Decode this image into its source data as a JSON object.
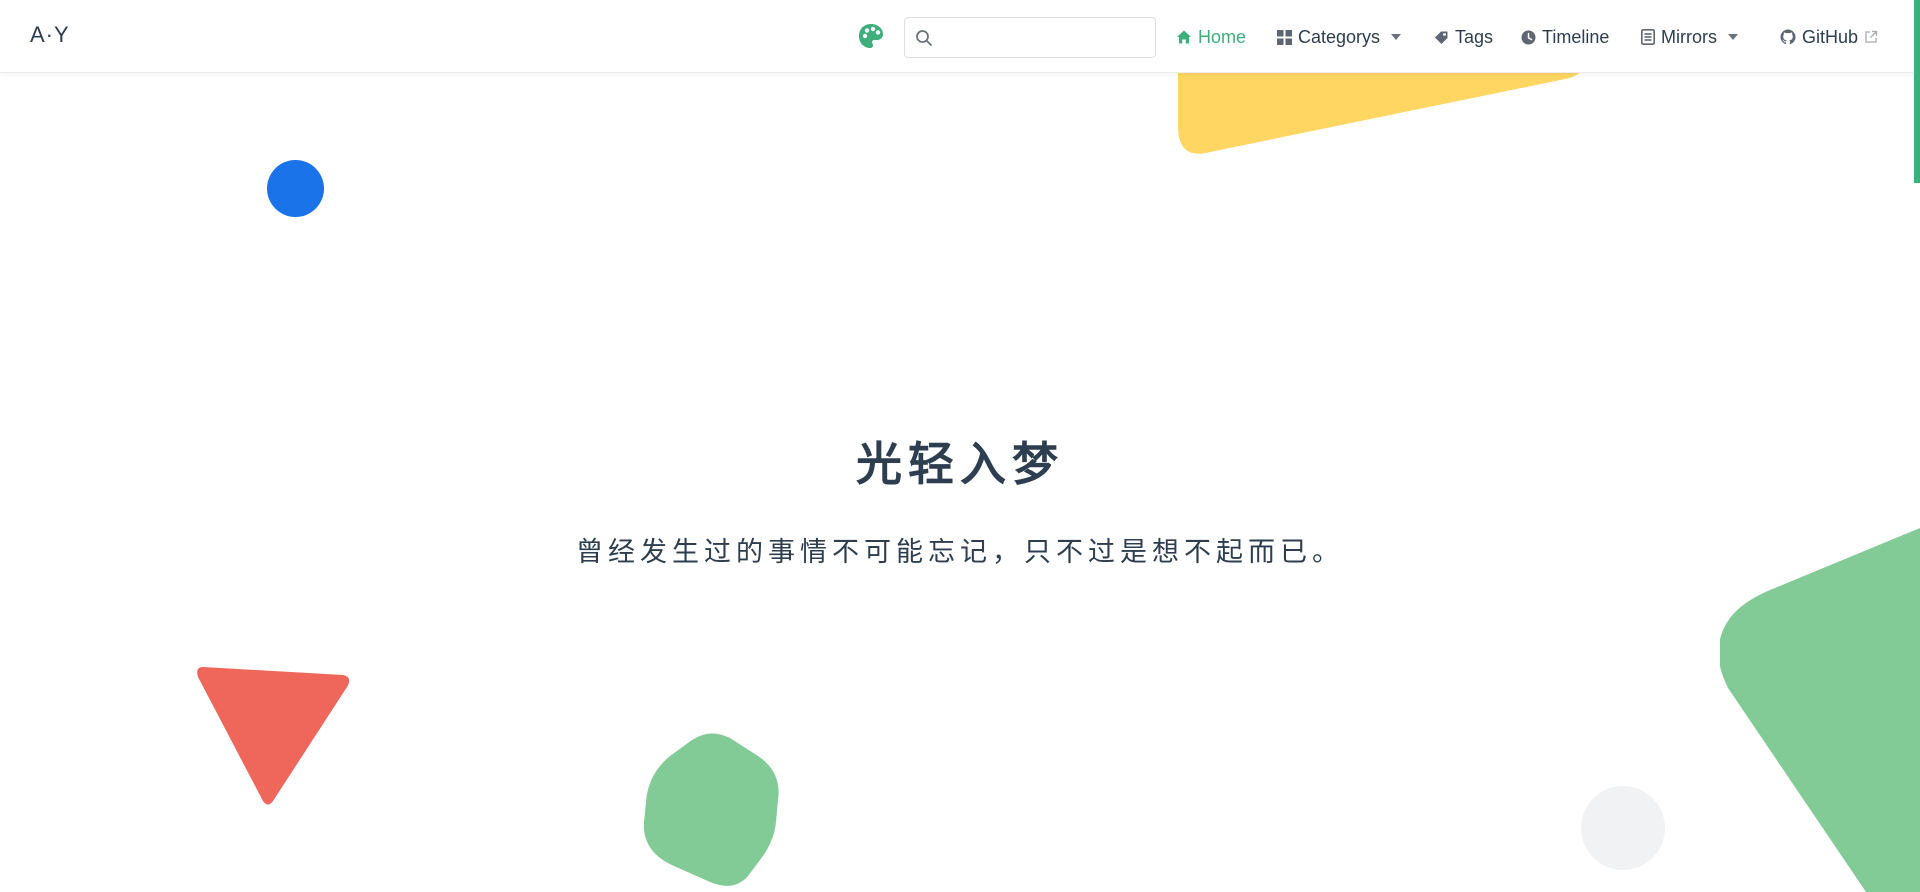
{
  "brand": {
    "text": "A·Y"
  },
  "search": {
    "placeholder": "",
    "value": ""
  },
  "nav": {
    "home": "Home",
    "categories": "Categorys",
    "tags": "Tags",
    "timeline": "Timeline",
    "mirrors": "Mirrors",
    "github": "GitHub"
  },
  "hero": {
    "title": "光轻入梦",
    "subtitle": "曾经发生过的事情不可能忘记，只不过是想不起而已。"
  },
  "colors": {
    "accent": "#3eaf7c",
    "text": "#2c3e50",
    "yellow": "#ffd662",
    "blue": "#1a73e8",
    "red": "#ef665b",
    "green": "#83cb96",
    "gray": "#f1f2f4"
  },
  "icons": [
    "palette-icon",
    "search-icon",
    "home-icon",
    "grid-icon",
    "tag-icon",
    "clock-icon",
    "list-icon",
    "github-icon",
    "external-link-icon",
    "caret-down-icon"
  ]
}
